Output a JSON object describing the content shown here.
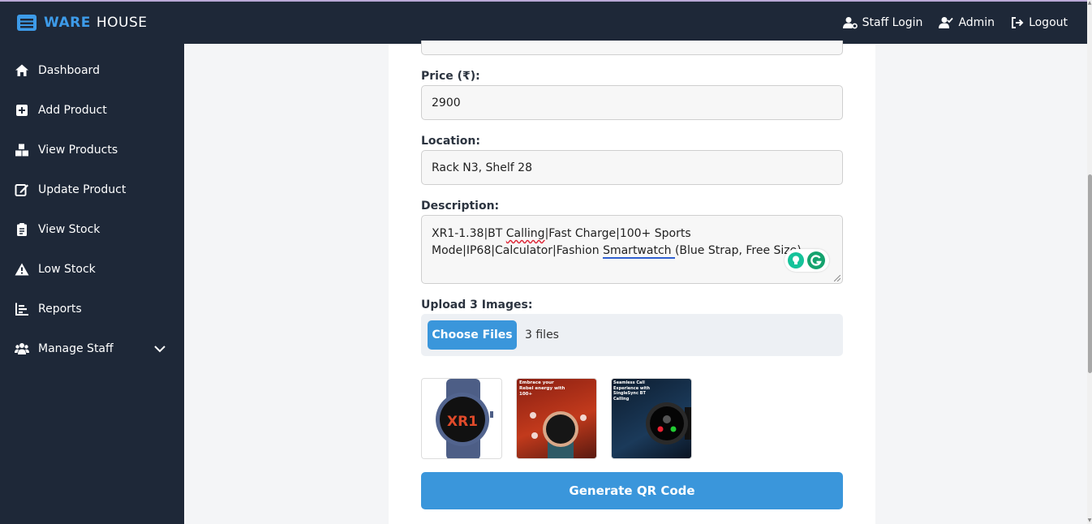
{
  "brand": {
    "ware": "WARE",
    "house": "HOUSE"
  },
  "topnav": {
    "staff_login": "Staff Login",
    "admin": "Admin",
    "logout": "Logout"
  },
  "sidebar": {
    "items": [
      {
        "label": "Dashboard",
        "icon": "home-icon"
      },
      {
        "label": "Add Product",
        "icon": "plus-square-icon"
      },
      {
        "label": "View Products",
        "icon": "boxes-icon"
      },
      {
        "label": "Update Product",
        "icon": "edit-icon"
      },
      {
        "label": "View Stock",
        "icon": "clipboard-icon"
      },
      {
        "label": "Low Stock",
        "icon": "warning-icon"
      },
      {
        "label": "Reports",
        "icon": "chart-icon"
      },
      {
        "label": "Manage Staff",
        "icon": "users-icon"
      }
    ]
  },
  "form": {
    "price": {
      "label": "Price (₹):",
      "value": "2900"
    },
    "location": {
      "label": "Location:",
      "value": "Rack N3, Shelf 28"
    },
    "description": {
      "label": "Description:",
      "part1": "XR1-1.38|BT ",
      "spell": "Calling",
      "part2": "|Fast Charge|100+ Sports Mode|IP68|Calculator|Fashion ",
      "grammar": "Smartwatch  ",
      "part3": "(Blue Strap, Free Size)"
    },
    "upload": {
      "label": "Upload 3 Images:",
      "button": "Choose Files",
      "count": "3 files"
    },
    "thumbnails": [
      {
        "caption": "XR1"
      },
      {
        "caption": "Embrace your Rebel energy with 100+"
      },
      {
        "caption": "Seamless Call Experience with SingleSync BT Calling"
      }
    ],
    "generate_button": "Generate QR Code"
  },
  "colors": {
    "sidebar_bg": "#1e2838",
    "accent": "#3a96db",
    "brand_blue": "#3d9be9"
  }
}
